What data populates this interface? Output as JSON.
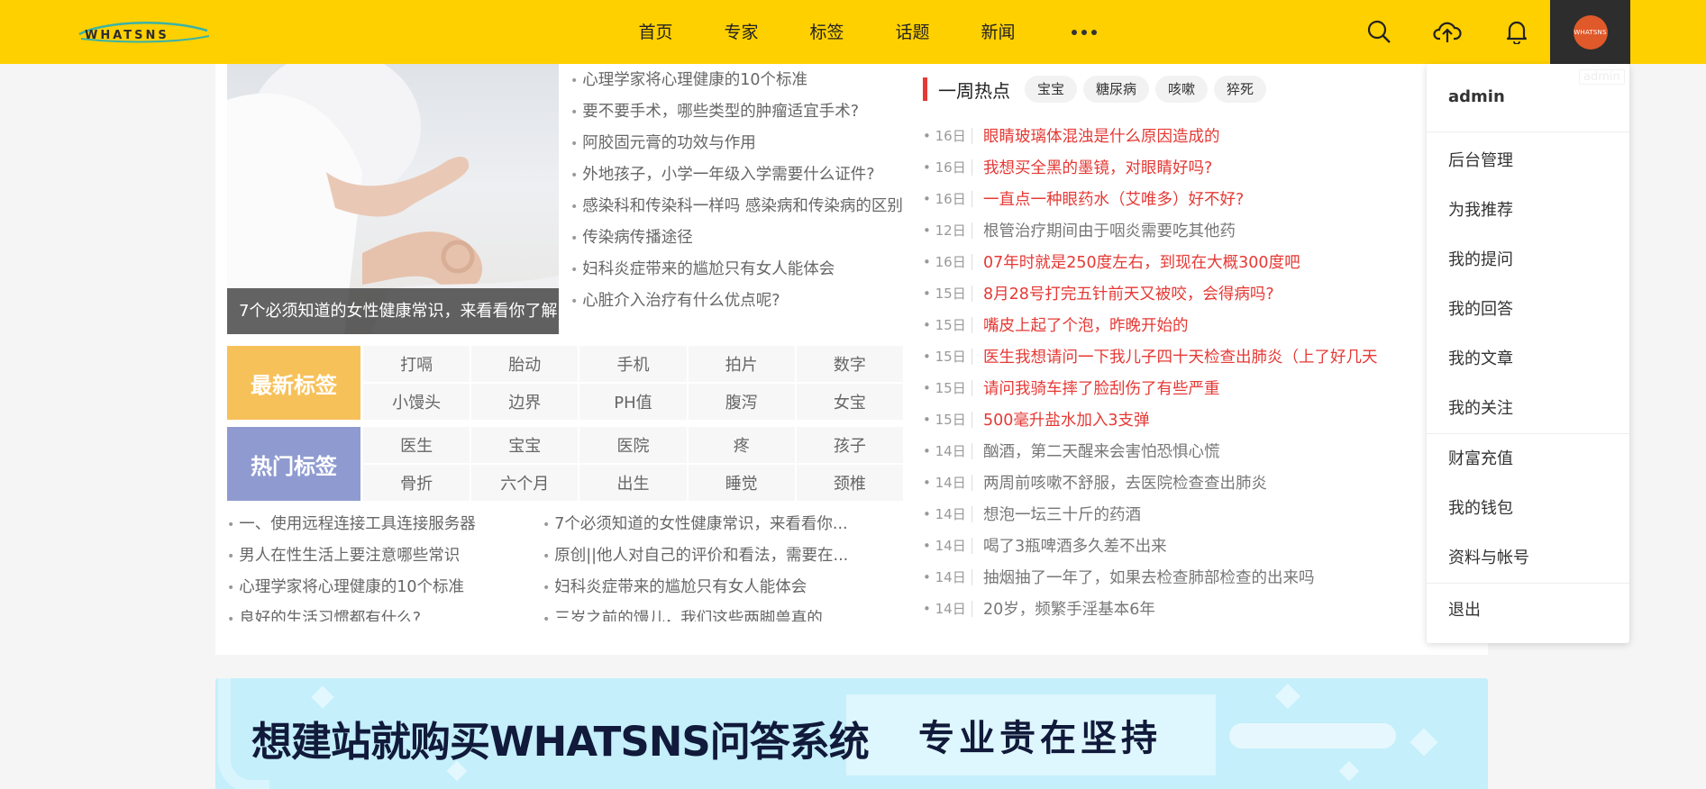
{
  "brand": {
    "logo_text": "WHATSNS"
  },
  "nav": {
    "items": [
      "首页",
      "专家",
      "标签",
      "话题",
      "新闻"
    ]
  },
  "user": {
    "avatar_text": "WHATSNS",
    "name": "admin",
    "ghost_label": "admin"
  },
  "hero": {
    "caption": "7个必须知道的女性健康常识，来看看你了解",
    "links": [
      "心理学家将心理健康的10个标准",
      "要不要手术，哪些类型的肿瘤适宜手术?",
      "阿胶固元膏的功效与作用",
      "外地孩子，小学一年级入学需要什么证件?",
      "感染科和传染科一样吗 感染病和传染病的区别",
      "传染病传播途径",
      "妇科炎症带来的尴尬只有女人能体会",
      "心脏介入治疗有什么优点呢?"
    ]
  },
  "tags": {
    "latest": {
      "title": "最新标签",
      "color": "#f7c15a",
      "items": [
        "打嗝",
        "胎动",
        "手机",
        "拍片",
        "数字",
        "小馒头",
        "边界",
        "PH值",
        "腹泻",
        "女宝"
      ]
    },
    "hot": {
      "title": "热门标签",
      "color": "#8f9bd0",
      "items": [
        "医生",
        "宝宝",
        "医院",
        "疼",
        "孩子",
        "骨折",
        "六个月",
        "出生",
        "睡觉",
        "颈椎"
      ]
    }
  },
  "bottom": {
    "left": [
      "一、使用远程连接工具连接服务器",
      "男人在性生活上要注意哪些常识",
      "心理学家将心理健康的10个标准",
      "良好的生活习惯都有什么?"
    ],
    "right": [
      "7个必须知道的女性健康常识，来看看你...",
      "原创||他人对自己的评价和看法，需要在...",
      "妇科炎症带来的尴尬只有女人能体会",
      "三岁之前的馒儿，我们这些两脚兽真的"
    ]
  },
  "hot": {
    "title": "一周热点",
    "tags": [
      "宝宝",
      "糖尿病",
      "咳嗽",
      "猝死"
    ],
    "items": [
      {
        "date": "16日",
        "text": "眼睛玻璃体混浊是什么原因造成的",
        "red": true
      },
      {
        "date": "16日",
        "text": "我想买全黑的墨镜，对眼睛好吗?",
        "red": true
      },
      {
        "date": "16日",
        "text": "一直点一种眼药水（艾唯多）好不好?",
        "red": true
      },
      {
        "date": "12日",
        "text": "根管治疗期间由于咽炎需要吃其他药",
        "red": false
      },
      {
        "date": "16日",
        "text": "07年时就是250度左右，到现在大概300度吧",
        "red": true
      },
      {
        "date": "15日",
        "text": "8月28号打完五针前天又被咬，会得病吗?",
        "red": true
      },
      {
        "date": "15日",
        "text": "嘴皮上起了个泡，昨晚开始的",
        "red": true
      },
      {
        "date": "15日",
        "text": "医生我想请问一下我儿子四十天检查出肺炎（上了好几天",
        "red": true
      },
      {
        "date": "15日",
        "text": "请问我骑车摔了脸刮伤了有些严重",
        "red": true
      },
      {
        "date": "15日",
        "text": "500毫升盐水加入3支弹",
        "red": true
      },
      {
        "date": "14日",
        "text": "酗酒，第二天醒来会害怕恐惧心慌",
        "red": false
      },
      {
        "date": "14日",
        "text": "两周前咳嗽不舒服，去医院检查查出肺炎",
        "red": false
      },
      {
        "date": "14日",
        "text": "想泡一坛三十斤的药酒",
        "red": false
      },
      {
        "date": "14日",
        "text": "喝了3瓶啤酒多久差不出来",
        "red": false
      },
      {
        "date": "14日",
        "text": "抽烟抽了一年了，如果去检查肺部检查的出来吗",
        "red": false
      },
      {
        "date": "14日",
        "text": "20岁，频繁手淫基本6年",
        "red": false
      }
    ]
  },
  "dropdown": {
    "group1": [
      "后台管理",
      "为我推荐",
      "我的提问",
      "我的回答",
      "我的文章",
      "我的关注"
    ],
    "group2": [
      "财富充值",
      "我的钱包",
      "资料与帐号"
    ],
    "group3": [
      "退出"
    ]
  },
  "banner": {
    "text": "想建站就购买WHATSNS问答系统",
    "slogan": "专业贵在坚持"
  },
  "colors": {
    "topbar": "#ffd000",
    "accent_red": "#e53935",
    "banner_bg": "#c4effb"
  }
}
